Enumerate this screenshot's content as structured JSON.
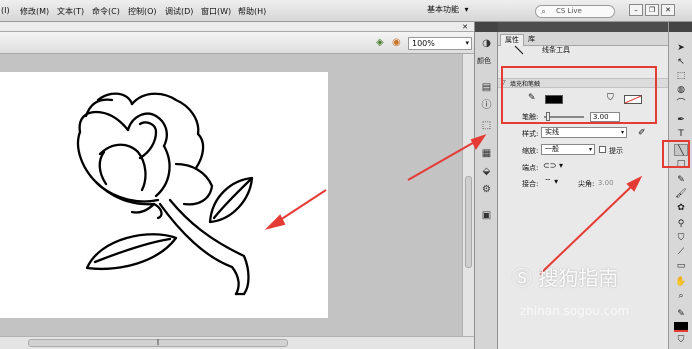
{
  "menubar": {
    "items": [
      "(I)",
      "修改(M)",
      "文本(T)",
      "命令(C)",
      "控制(O)",
      "调试(D)",
      "窗口(W)",
      "帮助(H)"
    ],
    "workspace": "基本功能",
    "search_placeholder": "CS Live"
  },
  "editbar": {
    "zoom": "100%"
  },
  "dock": {
    "label": "颜色"
  },
  "properties": {
    "tabs": [
      "属性",
      "库"
    ],
    "tool_name": "线条工具",
    "section_title": "填充和笔触",
    "stroke_label": "笔触:",
    "stroke_value": "3.00",
    "style_label": "样式:",
    "style_value": "实线",
    "scale_label": "缩放:",
    "scale_value": "一般",
    "hint_label": "提示",
    "cap_label": "端点:",
    "join_label": "接合:",
    "miter_label": "尖角:",
    "miter_value": "3.00"
  },
  "watermark": {
    "brand": "搜狗指南",
    "url": "zhinan.sogou.com"
  },
  "colors": {
    "annotation": "#e53b35",
    "stroke": "#000000",
    "fill_none": "#ffffff"
  }
}
